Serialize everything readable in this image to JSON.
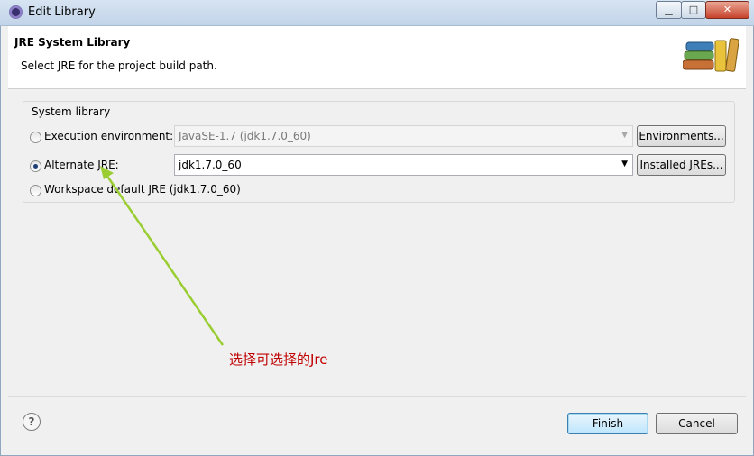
{
  "window": {
    "title": "Edit Library",
    "controls": {
      "minimize_icon": "minimize-icon",
      "maximize_icon": "maximize-icon",
      "close_icon": "close-icon"
    }
  },
  "header": {
    "title": "JRE System Library",
    "description": "Select JRE for the project build path."
  },
  "group": {
    "label": "System library",
    "options": [
      {
        "label": "Execution environment:",
        "selected": false,
        "combo_value": "JavaSE-1.7 (jdk1.7.0_60)",
        "combo_enabled": false,
        "button_label": "Environments..."
      },
      {
        "label": "Alternate JRE:",
        "selected": true,
        "combo_value": "jdk1.7.0_60",
        "combo_enabled": true,
        "button_label": "Installed JREs..."
      },
      {
        "label": "Workspace default JRE (jdk1.7.0_60)",
        "selected": false
      }
    ]
  },
  "annotation": {
    "text": "选择可选择的Jre",
    "color": "#c00000",
    "arrow_color": "#9acd32"
  },
  "footer": {
    "help_label": "?",
    "finish_label": "Finish",
    "cancel_label": "Cancel"
  }
}
